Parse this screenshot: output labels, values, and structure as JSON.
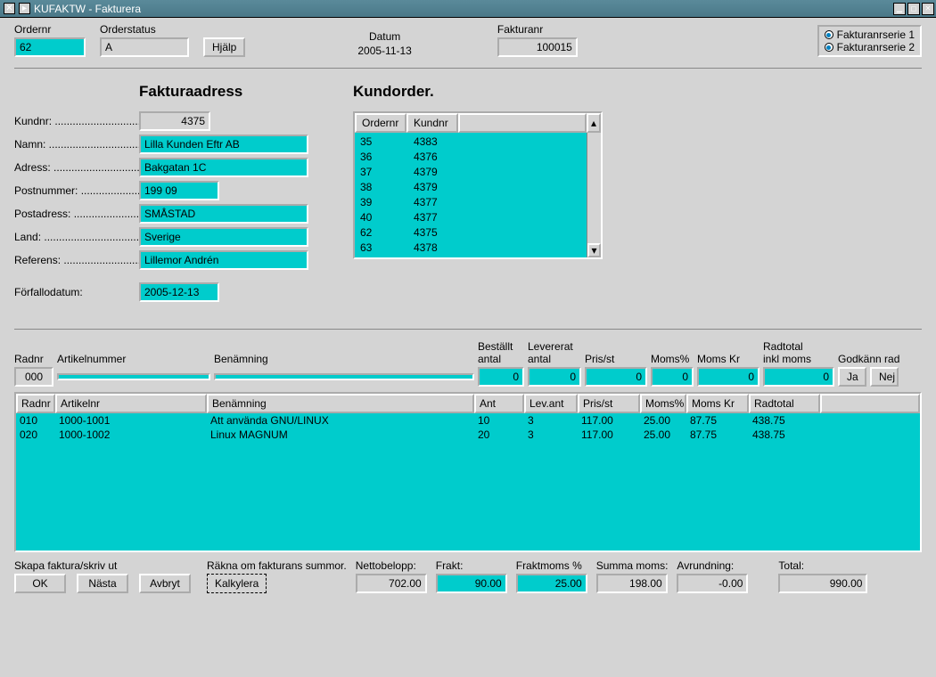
{
  "window": {
    "title": "KUFAKTW - Fakturera"
  },
  "top": {
    "ordernr_lbl": "Ordernr",
    "ordernr": "62",
    "orderstatus_lbl": "Orderstatus",
    "orderstatus": "A",
    "hjalp": "Hjälp",
    "datum_lbl": "Datum",
    "datum": "2005-11-13",
    "fakturanr_lbl": "Fakturanr",
    "fakturanr": "100015",
    "serie1": "Fakturanrserie 1",
    "serie2": "Fakturanrserie 2"
  },
  "addr": {
    "title": "Fakturaadress",
    "kundnr_lbl": "Kundnr:",
    "kundnr": "4375",
    "namn_lbl": "Namn:",
    "namn": "Lilla Kunden Eftr AB",
    "adress_lbl": "Adress:",
    "adress": "Bakgatan 1C",
    "postnr_lbl": "Postnummer:",
    "postnr": "199 09",
    "postadr_lbl": "Postadress:",
    "postadr": "SMÅSTAD",
    "land_lbl": "Land:",
    "land": "Sverige",
    "ref_lbl": "Referens:",
    "ref": "Lillemor Andrén",
    "forf_lbl": "Förfallodatum:",
    "forf": "2005-12-13"
  },
  "kundorder": {
    "title": "Kundorder.",
    "h1": "Ordernr",
    "h2": "Kundnr",
    "rows": [
      {
        "o": "35",
        "k": "4383"
      },
      {
        "o": "36",
        "k": "4376"
      },
      {
        "o": "37",
        "k": "4379"
      },
      {
        "o": "38",
        "k": "4379"
      },
      {
        "o": "39",
        "k": "4377"
      },
      {
        "o": "40",
        "k": "4377"
      },
      {
        "o": "62",
        "k": "4375"
      },
      {
        "o": "63",
        "k": "4378"
      }
    ]
  },
  "entry": {
    "radnr_lbl": "Radnr",
    "artnr_lbl": "Artikelnummer",
    "benamn_lbl": "Benämning",
    "best_lbl1": "Beställt",
    "best_lbl2": "antal",
    "lev_lbl1": "Levererat",
    "lev_lbl2": "antal",
    "pris_lbl": "Pris/st",
    "momsp_lbl": "Moms%",
    "momskr_lbl": "Moms Kr",
    "radtot_lbl1": "Radtotal",
    "radtot_lbl2": "inkl moms",
    "godk_lbl": "Godkänn rad",
    "radnr": "000",
    "bestallt": "0",
    "lev": "0",
    "pris": "0",
    "momsp": "0",
    "momskr": "0",
    "radtot": "0",
    "ja": "Ja",
    "nej": "Nej"
  },
  "lines": {
    "h_radnr": "Radnr",
    "h_artnr": "Artikelnr",
    "h_benamn": "Benämning",
    "h_ant": "Ant",
    "h_levant": "Lev.ant",
    "h_pris": "Pris/st",
    "h_momsp": "Moms%",
    "h_momskr": "Moms Kr",
    "h_radtot": "Radtotal",
    "rows": [
      {
        "r": "010",
        "a": "1000-1001",
        "b": "Att använda GNU/LINUX",
        "ant": "10",
        "lev": "3",
        "pris": "117.00",
        "mp": "25.00",
        "mk": "87.75",
        "rt": "438.75"
      },
      {
        "r": "020",
        "a": "1000-1002",
        "b": "Linux MAGNUM",
        "ant": "20",
        "lev": "3",
        "pris": "117.00",
        "mp": "25.00",
        "mk": "87.75",
        "rt": "438.75"
      }
    ]
  },
  "bottom": {
    "skapa_lbl": "Skapa faktura/skriv ut",
    "ok": "OK",
    "nasta": "Nästa",
    "avbryt": "Avbryt",
    "rakna_lbl": "Räkna om fakturans summor.",
    "kalkylera": "Kalkylera",
    "netto_lbl": "Nettobelopp:",
    "netto": "702.00",
    "frakt_lbl": "Frakt:",
    "frakt": "90.00",
    "fraktmoms_lbl": "Fraktmoms %",
    "fraktmoms": "25.00",
    "summamoms_lbl": "Summa moms:",
    "summamoms": "198.00",
    "avrund_lbl": "Avrundning:",
    "avrund": "-0.00",
    "total_lbl": "Total:",
    "total": "990.00"
  }
}
